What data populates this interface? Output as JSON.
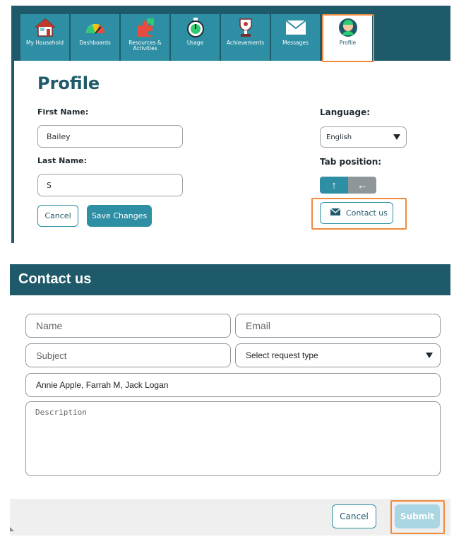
{
  "nav": {
    "tabs": [
      {
        "label": "My Household",
        "icon": "house-icon"
      },
      {
        "label": "Dashboards",
        "icon": "gauge-icon"
      },
      {
        "label": "Resources & Activities",
        "icon": "puzzle-icon"
      },
      {
        "label": "Usage",
        "icon": "stopwatch-icon"
      },
      {
        "label": "Achievements",
        "icon": "trophy-icon"
      },
      {
        "label": "Messages",
        "icon": "envelope-icon"
      },
      {
        "label": "Profile",
        "icon": "avatar-icon"
      }
    ],
    "active_tab": "Profile"
  },
  "profile": {
    "title": "Profile",
    "first_name_label": "First Name:",
    "first_name_value": "Bailey",
    "last_name_label": "Last Name:",
    "last_name_value": "S",
    "cancel_label": "Cancel",
    "save_label": "Save Changes",
    "language_label": "Language:",
    "language_value": "English",
    "tab_position_label": "Tab position:",
    "tab_position_up": "↑",
    "tab_position_left": "←",
    "contact_label": "Contact us"
  },
  "contact": {
    "title": "Contact us",
    "name_placeholder": "Name",
    "email_placeholder": "Email",
    "subject_placeholder": "Subject",
    "request_type_value": "Select request type",
    "recipients_value": "Annie Apple, Farrah M, Jack Logan",
    "description_placeholder": "Description",
    "cancel_label": "Cancel",
    "submit_label": "Submit"
  },
  "colors": {
    "brand_dark": "#1f5a6b",
    "brand": "#2e8ea4",
    "highlight": "#f08a3c"
  }
}
